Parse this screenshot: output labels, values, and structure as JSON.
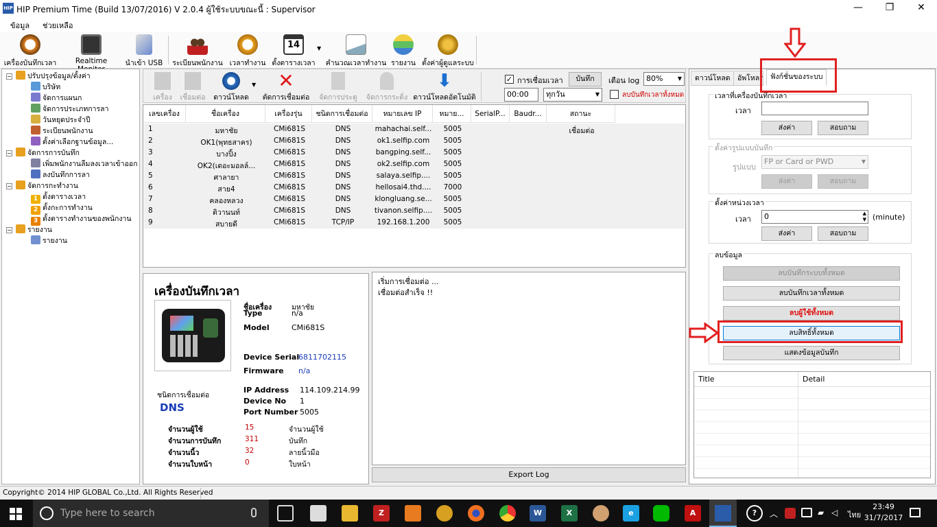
{
  "window": {
    "title": "HIP Premium Time (Build 13/07/2016) V 2.0.4   ผู้ใช้ระบบขณะนี้ : Supervisor",
    "app_icon_text": "HIP"
  },
  "menu": [
    "ข้อมูล",
    "ช่วยเหลือ"
  ],
  "toolbar": [
    "เครื่องบันทึกเวลา",
    "Realtime Monitor",
    "นำเข้า USB",
    "ระเบียนพนักงาน",
    "เวลาทำงาน",
    "ตั้งตารางเวลา",
    "คำนวณเวลาทำงาน",
    "รายงาน",
    "ตั้งค่าผู้ดูแลระบบ"
  ],
  "calendar_day": "14",
  "tree": [
    {
      "label": "ปรับปรุงข้อมูล/ตั้งค่า",
      "level": 0,
      "icon": "folder-icon"
    },
    {
      "label": "บริษัท",
      "level": 1,
      "icon": "building-icon"
    },
    {
      "label": "จัดการแผนก",
      "level": 1,
      "icon": "department-icon"
    },
    {
      "label": "จัดการประเภทการลา",
      "level": 1,
      "icon": "leave-type-icon"
    },
    {
      "label": "วันหยุดประจำปี",
      "level": 1,
      "icon": "holiday-icon"
    },
    {
      "label": "ระเบียนพนักงาน",
      "level": 1,
      "icon": "employee-icon"
    },
    {
      "label": "ตั้งค่าเลือกฐานข้อมูล...",
      "level": 1,
      "icon": "database-icon"
    },
    {
      "label": "จัดการการบันทึก",
      "level": 0,
      "icon": "folder-icon"
    },
    {
      "label": "เพิ่มพนักงานลืมลงเวลาเข้าออก",
      "level": 1,
      "icon": "gear-icon"
    },
    {
      "label": "ลงบันทึกการลา",
      "level": 1,
      "icon": "leave-record-icon"
    },
    {
      "label": "จัดการกะทำงาน",
      "level": 0,
      "icon": "folder-icon"
    },
    {
      "label": "ตั้งตารางเวลา",
      "level": 1,
      "icon": "number-1-icon",
      "num": "1"
    },
    {
      "label": "ตั้งกะการทำงาน",
      "level": 1,
      "icon": "number-2-icon",
      "num": "2"
    },
    {
      "label": "ตั้งตารางทำงานของพนักงาน",
      "level": 1,
      "icon": "number-3-icon",
      "num": "3"
    },
    {
      "label": "รายงาน",
      "level": 0,
      "icon": "folder-icon"
    },
    {
      "label": "รายงาน",
      "level": 1,
      "icon": "report-chart-icon"
    }
  ],
  "center_toolbar": {
    "buttons": [
      "เครื่อง",
      "เชื่อมต่อ",
      "ดาวน์โหลด",
      "ตัดการเชื่อมต่อ",
      "จัดการประตู",
      "จัดการกระดิ่ง",
      "ดาวน์โหลดอัตโนมัติ"
    ],
    "connect_time_label": "การเชื่อมเวลา",
    "save_label": "บันทึก",
    "time_value": "00:00",
    "day_value": "ทุกวัน",
    "log_warn_label": "เตือน log",
    "log_percent": "80%",
    "delete_all_label": "ลบบันทึกเวลาทั้งหมด"
  },
  "grid": {
    "headers": [
      "เลขเครื่อง",
      "ชื่อเครื่อง",
      "เครื่องรุ่น",
      "ชนิดการเชื่อมต่อ",
      "หมายเลข IP",
      "หมาย...",
      "SerialP...",
      "Baudr...",
      "สถานะ"
    ],
    "rows": [
      [
        "1",
        "มหาชัย",
        "CMi681S",
        "DNS",
        "mahachai.self...",
        "5005",
        "",
        "",
        "เชื่อมต่อ"
      ],
      [
        "2",
        "OK1(พุทธสาคร)",
        "CMi681S",
        "DNS",
        "ok1.selfip.com",
        "5005",
        "",
        "",
        ""
      ],
      [
        "3",
        "บางปิ้ง",
        "CMi681S",
        "DNS",
        "bangping.self...",
        "5005",
        "",
        "",
        ""
      ],
      [
        "4",
        "OK2(เดอะมอลล์...",
        "CMi681S",
        "DNS",
        "ok2.selfip.com",
        "5005",
        "",
        "",
        ""
      ],
      [
        "5",
        "ศาลายา",
        "CMi681S",
        "DNS",
        "salaya.selfip....",
        "5005",
        "",
        "",
        ""
      ],
      [
        "6",
        "สาย4",
        "CMi681S",
        "DNS",
        "hellosai4.thd....",
        "7000",
        "",
        "",
        ""
      ],
      [
        "7",
        "คลองหลวง",
        "CMi681S",
        "DNS",
        "klongluang.se...",
        "5005",
        "",
        "",
        ""
      ],
      [
        "8",
        "ติวานนท์",
        "CMi681S",
        "DNS",
        "tivanon.selfip....",
        "5005",
        "",
        "",
        ""
      ],
      [
        "9",
        "สบายดี",
        "CMi681S",
        "TCP/IP",
        "192.168.1.200",
        "5005",
        "",
        "",
        ""
      ]
    ]
  },
  "device": {
    "heading": "เครื่องบันทึกเวลา",
    "name_label": "ชื่อเครื่อง",
    "name": "มหาชัย",
    "type_label": "Type",
    "type": "n/a",
    "model_label": "Model",
    "model": "CMi681S",
    "serial_label": "Device Serial",
    "serial": "6811702115",
    "firmware_label": "Firmware",
    "firmware": "n/a",
    "conn_type_label": "ชนิดการเชื่อมต่อ",
    "conn_type": "DNS",
    "ip_label": "IP Address",
    "ip": "114.109.214.99",
    "devno_label": "Device No",
    "devno": "1",
    "port_label": "Port Number",
    "port": "5005",
    "stats": [
      {
        "label": "จำนวนผู้ใช้",
        "value": "15",
        "unit": "จำนวนผู้ใช้"
      },
      {
        "label": "จำนวนการบันทึก",
        "value": "311",
        "unit": "บันทึก"
      },
      {
        "label": "จำนวนนิ้ว",
        "value": "32",
        "unit": "ลายนิ้วมือ"
      },
      {
        "label": "จำนวนใบหน้า",
        "value": "0",
        "unit": "ใบหน้า"
      }
    ]
  },
  "log": [
    "เริ่มการเชื่อมต่อ ...",
    "เชื่อมต่อสำเร็จ !!"
  ],
  "export_log": "Export Log",
  "right": {
    "tabs": [
      "ดาวน์โหลด",
      "อัพโหลด",
      "ฟังก์ชั่นของระบบ"
    ],
    "time_group": "เวลาที่เครื่องบันทึกเวลา",
    "time_label": "เวลา",
    "send": "ส่งค่า",
    "query": "สอบถาม",
    "format_group": "ตั้งค่ารูปแบบบันทึก",
    "format_label": "รูปแบบ",
    "format_value": "FP or Card or PWD",
    "interval_group": "ตั้งค่าหน่วงเวลา",
    "interval_value": "0",
    "interval_unit": "(minute)",
    "delete_group": "ลบข้อมูล",
    "delete_buttons": [
      "ลบบันทึกระบบทั้งหมด",
      "ลบบันทึกเวลาทั้งหมด",
      "ลบผู้ใช้ทั้งหมด",
      "ลบสิทธิ์ทั้งหมด",
      "แสดงข้อมูลบันทึก"
    ],
    "table_headers": [
      "Title",
      "Detail"
    ]
  },
  "status": "Copyright© 2014 HIP GLOBAL Co.,Ltd. All Rights Reserved",
  "taskbar": {
    "search": "Type here to search",
    "time": "23:49",
    "date": "31/7/2017",
    "lang": "ไทย"
  },
  "colors": {
    "highlight": "#e02020",
    "link_blue": "#1a3cb8",
    "value_red": "#c00000"
  }
}
